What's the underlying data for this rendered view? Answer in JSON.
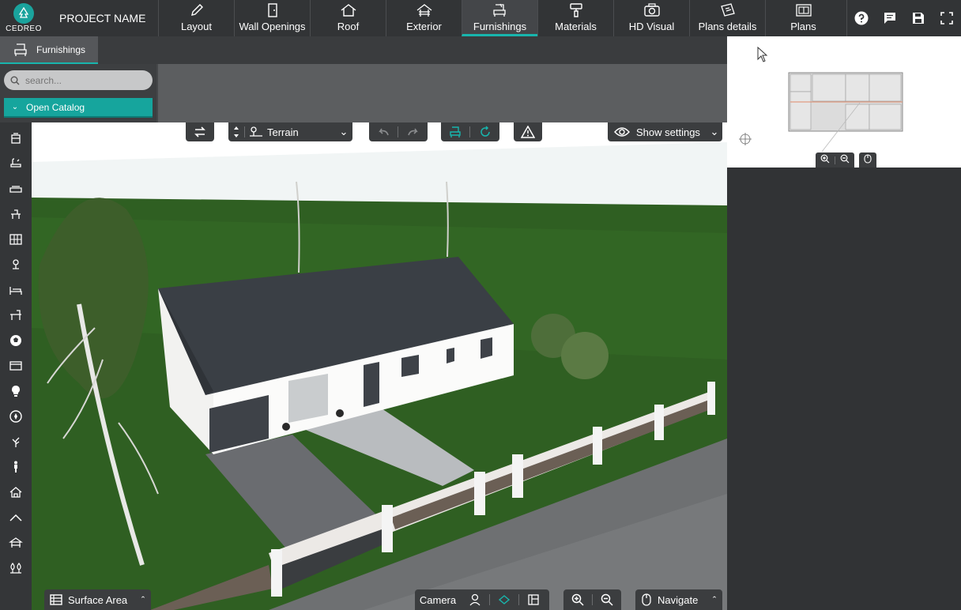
{
  "topbar": {
    "brand": "CEDREO",
    "project_name": "PROJECT NAME",
    "tabs": [
      {
        "label": "Layout",
        "icon": "pencil-icon"
      },
      {
        "label": "Wall Openings",
        "icon": "door-icon"
      },
      {
        "label": "Roof",
        "icon": "roof-icon"
      },
      {
        "label": "Exterior",
        "icon": "exterior-icon"
      },
      {
        "label": "Furnishings",
        "icon": "armchair-icon",
        "active": true
      },
      {
        "label": "Materials",
        "icon": "paint-roller-icon"
      },
      {
        "label": "HD Visual",
        "icon": "camera-icon"
      },
      {
        "label": "Plans details",
        "icon": "plans-details-icon"
      },
      {
        "label": "Plans",
        "icon": "plans-icon"
      }
    ],
    "right_icons": [
      "help-icon",
      "chat-icon",
      "save-icon",
      "fullscreen-icon"
    ]
  },
  "subbar": {
    "tab_label": "Furnishings"
  },
  "leftpanel": {
    "search_placeholder": "search...",
    "catalog_label": "Open Catalog"
  },
  "viewport_toolbar": {
    "terrain_label": "Terrain",
    "settings_label": "Show settings"
  },
  "bottom_bar": {
    "surface_label": "Surface Area",
    "camera_label": "Camera",
    "navigate_label": "Navigate"
  },
  "side_icons": [
    "kitchen-icon",
    "bathroom-icon",
    "living-icon",
    "dining-icon",
    "storage-icon",
    "lamp-icon",
    "bedroom-icon",
    "office-icon",
    "ball-icon",
    "appliance-icon",
    "bulb-icon",
    "compass-icon",
    "plant-icon",
    "person-icon",
    "house-icon",
    "roof-line-icon",
    "gazebo-icon",
    "trees-icon"
  ],
  "colors": {
    "accent": "#18b5ad",
    "topbar": "#323436",
    "sky": "#f1f5f5",
    "grass": "#2f5f22",
    "roof": "#3a3f45"
  }
}
